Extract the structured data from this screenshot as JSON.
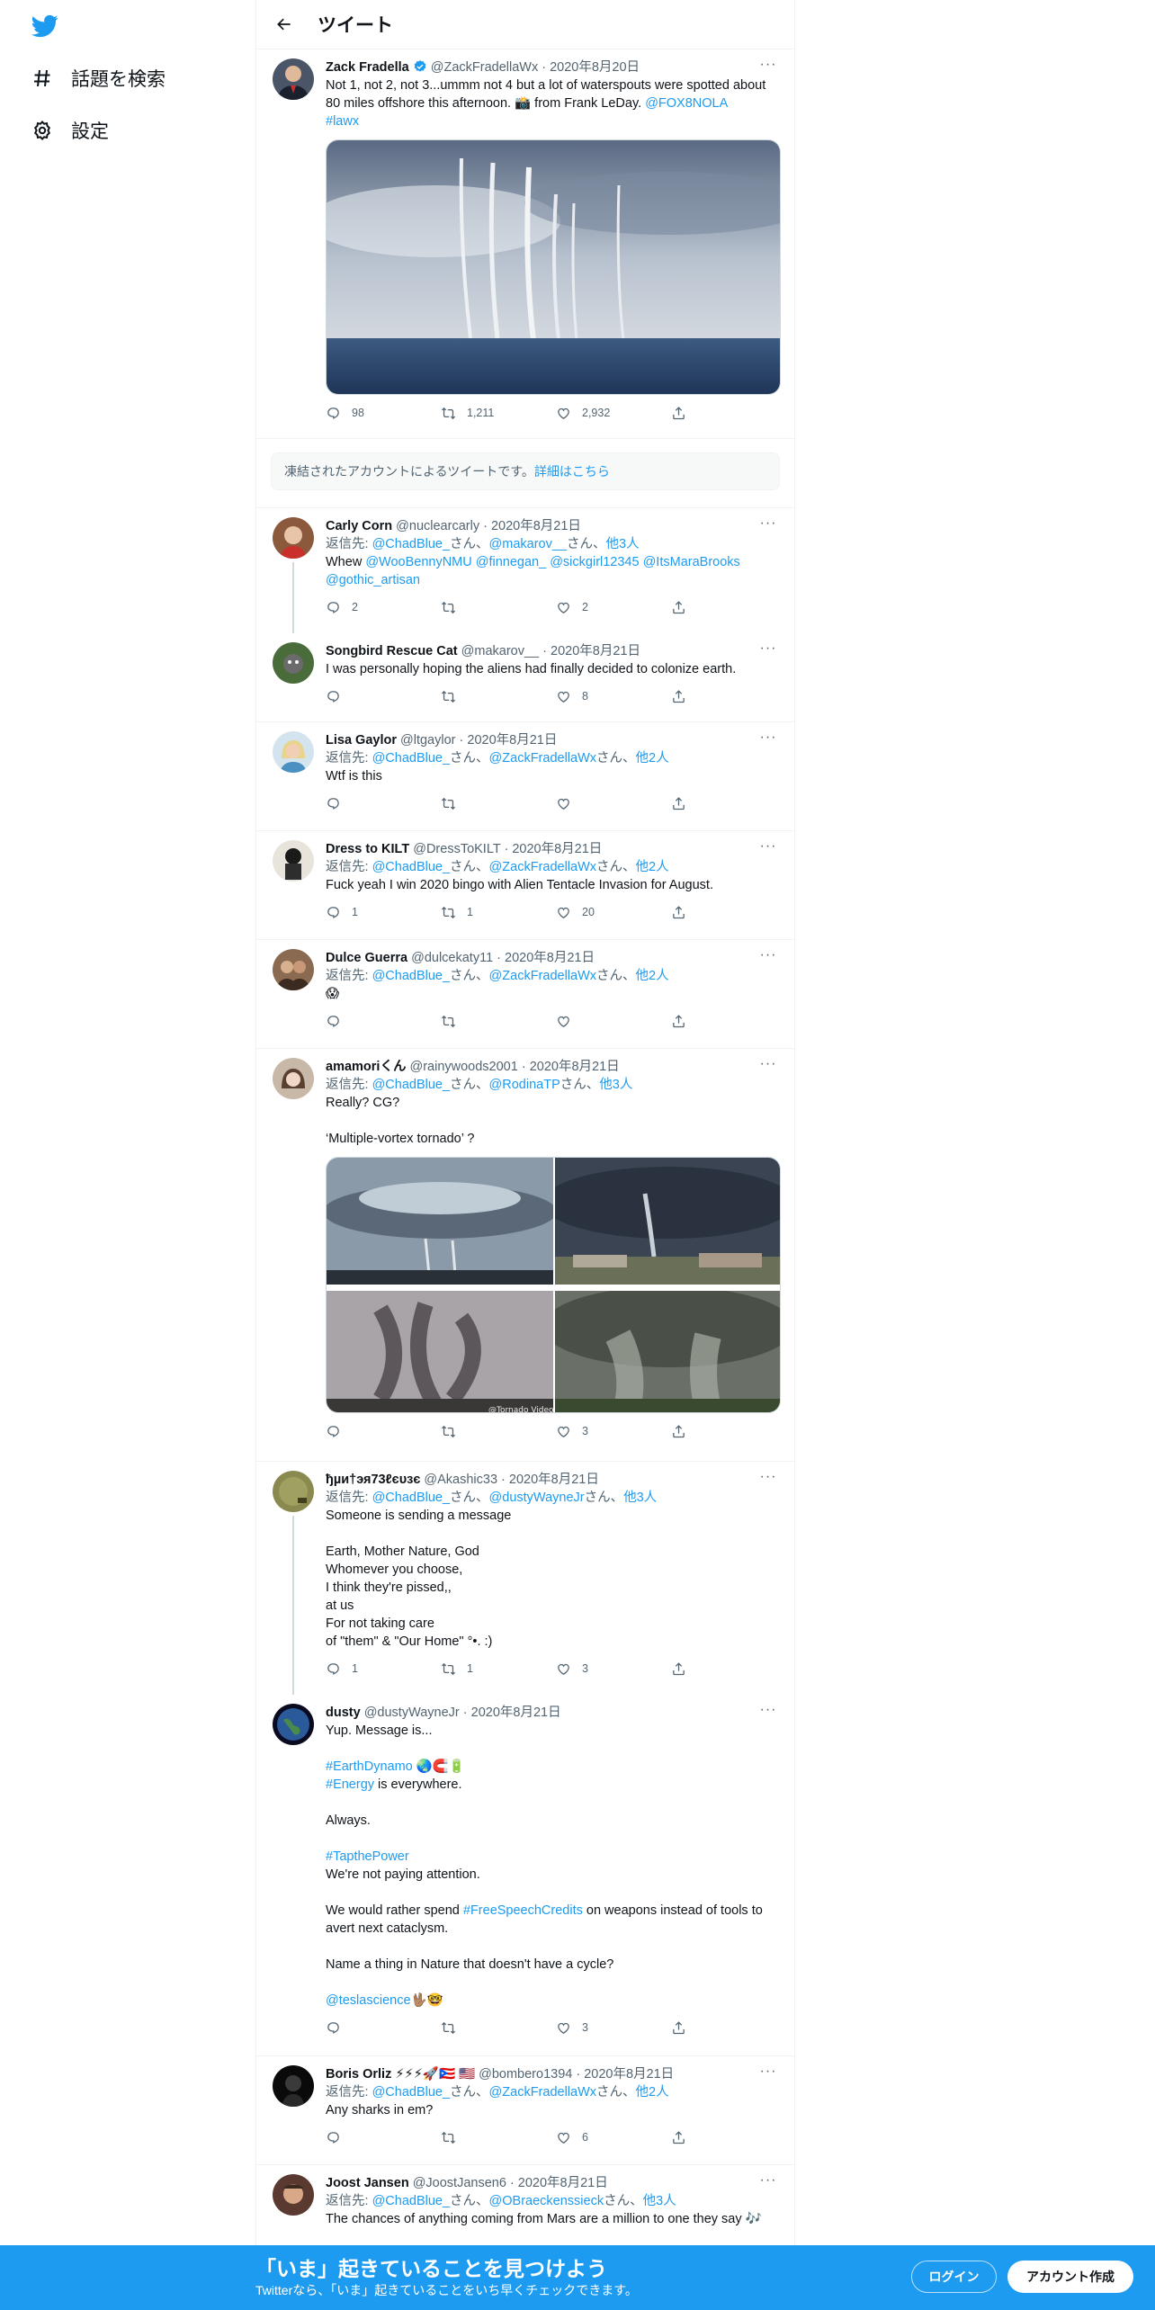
{
  "nav": {
    "explore_label": "話題を検索",
    "settings_label": "設定"
  },
  "header": {
    "title": "ツイート"
  },
  "main_tweet": {
    "name": "Zack Fradella",
    "handle": "@ZackFradellaWx",
    "date": "2020年8月20日",
    "text": "Not 1, not 2, not 3...ummm not 4 but a lot of waterspouts were spotted about 80 miles offshore this afternoon. 📸 from Frank LeDay. ",
    "mention": "@FOX8NOLA",
    "hashtag": "#lawx",
    "replies": "98",
    "retweets": "1,211",
    "likes": "2,932"
  },
  "notice": {
    "text": "凍結されたアカウントによるツイートです。",
    "link": "詳細はこちら"
  },
  "replies": [
    {
      "name": "Carly Corn",
      "handle": "@nuclearcarly",
      "date": "2020年8月21日",
      "reply_to_prefix": "返信先: ",
      "reply_to_1": "@ChadBlue_",
      "sep1": "さん、",
      "reply_to_2": "@makarov__",
      "sep2": "さん、",
      "reply_to_more": "他3人",
      "text_prefix": "Whew ",
      "text_links": "@WooBennyNMU @finnegan_ @sickgirl12345 @ItsMaraBrooks @gothic_artisan",
      "replies": "2",
      "retweets": "",
      "likes": "2"
    },
    {
      "name": "Songbird Rescue Cat",
      "handle": "@makarov__",
      "date": "2020年8月21日",
      "text": "I was personally hoping the aliens had finally decided to colonize earth.",
      "replies": "",
      "retweets": "",
      "likes": "8"
    },
    {
      "name": "Lisa Gaylor",
      "handle": "@ltgaylor",
      "date": "2020年8月21日",
      "reply_to_prefix": "返信先: ",
      "reply_to_1": "@ChadBlue_",
      "sep1": "さん、",
      "reply_to_2": "@ZackFradellaWx",
      "sep2": "さん、",
      "reply_to_more": "他2人",
      "text": "Wtf is this",
      "replies": "",
      "retweets": "",
      "likes": ""
    },
    {
      "name": "Dress to KILT",
      "handle": "@DressToKILT",
      "date": "2020年8月21日",
      "reply_to_prefix": "返信先: ",
      "reply_to_1": "@ChadBlue_",
      "sep1": "さん、",
      "reply_to_2": "@ZackFradellaWx",
      "sep2": "さん、",
      "reply_to_more": "他2人",
      "text": "Fuck yeah I win 2020 bingo with Alien Tentacle Invasion for August.",
      "replies": "1",
      "retweets": "1",
      "likes": "20"
    },
    {
      "name": "Dulce Guerra",
      "handle": "@dulcekaty11",
      "date": "2020年8月21日",
      "reply_to_prefix": "返信先: ",
      "reply_to_1": "@ChadBlue_",
      "sep1": "さん、",
      "reply_to_2": "@ZackFradellaWx",
      "sep2": "さん、",
      "reply_to_more": "他2人",
      "text": "😱",
      "replies": "",
      "retweets": "",
      "likes": ""
    },
    {
      "name": "amamoriくん",
      "handle": "@rainywoods2001",
      "date": "2020年8月21日",
      "reply_to_prefix": "返信先: ",
      "reply_to_1": "@ChadBlue_",
      "sep1": "さん、",
      "reply_to_2": "@RodinaTP",
      "sep2": "さん、",
      "reply_to_more": "他3人",
      "text": "Really? CG?\n\n‘Multiple-vortex tornado’ ?",
      "watermark": "@Tornado Video",
      "replies": "",
      "retweets": "",
      "likes": "3"
    },
    {
      "name": "ђµи†эя73ℓєυзє",
      "handle": "@Akashic33",
      "date": "2020年8月21日",
      "reply_to_prefix": "返信先: ",
      "reply_to_1": "@ChadBlue_",
      "sep1": "さん、",
      "reply_to_2": "@dustyWayneJr",
      "sep2": "さん、",
      "reply_to_more": "他3人",
      "text": "Someone is sending a message\n\nEarth, Mother Nature, God\nWhomever you choose,\nI think they're pissed,,\nat us\nFor not taking care\nof \"them\" & \"Our Home\" °•. :)",
      "replies": "1",
      "retweets": "1",
      "likes": "3"
    },
    {
      "name": "dusty",
      "handle": "@dustyWayneJr",
      "date": "2020年8月21日",
      "line1": "Yup. Message is...",
      "tag1": "#EarthDynamo",
      "emoji1": " 🌏🧲🔋",
      "tag2": "#Energy",
      "line2": " is everywhere.",
      "line3": "Always.",
      "tag3": "#TapthePower",
      "line4": "We're not paying attention.",
      "line5a": "We would rather spend ",
      "tag4": "#FreeSpeechCredits",
      "line5b": " on weapons instead of tools to avert next cataclysm.",
      "line6": "Name a thing in Nature that doesn't have a cycle?",
      "tag5": "@teslascience",
      "emoji2": "🖖🏽🤓",
      "replies": "",
      "retweets": "",
      "likes": "3"
    },
    {
      "name": "Boris Orliz ⚡⚡⚡🚀🇵🇷 🇺🇸",
      "handle": "@bombero1394",
      "date": "2020年8月21日",
      "reply_to_prefix": "返信先: ",
      "reply_to_1": "@ChadBlue_",
      "sep1": "さん、",
      "reply_to_2": "@ZackFradellaWx",
      "sep2": "さん、",
      "reply_to_more": "他2人",
      "text": "Any sharks in em?",
      "replies": "",
      "retweets": "",
      "likes": "6"
    },
    {
      "name": "Joost Jansen",
      "handle": "@JoostJansen6",
      "date": "2020年8月21日",
      "reply_to_prefix": "返信先: ",
      "reply_to_1": "@ChadBlue_",
      "sep1": "さん、",
      "reply_to_2": "@OBraeckenssieck",
      "sep2": "さん、",
      "reply_to_more": "他3人",
      "text": "The chances of anything coming from Mars are a million to one they say 🎶"
    }
  ],
  "banner": {
    "title": "「いま」起きていることを見つけよう",
    "subtitle": "Twitterなら、「いま」起きていることをいち早くチェックできます。",
    "login": "ログイン",
    "signup": "アカウント作成"
  },
  "colors": {
    "accent": "#1d9bf0",
    "text": "#0f1419",
    "muted": "#536471"
  }
}
